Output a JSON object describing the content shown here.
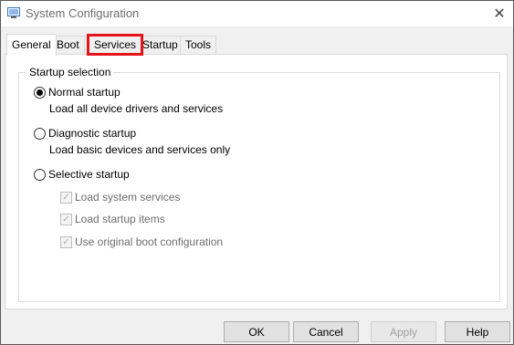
{
  "window": {
    "title": "System Configuration",
    "close_glyph": "✕"
  },
  "tabs": [
    {
      "label": "General"
    },
    {
      "label": "Boot"
    },
    {
      "label": "Services"
    },
    {
      "label": "Startup"
    },
    {
      "label": "Tools"
    }
  ],
  "startup_selection": {
    "group_title": "Startup selection",
    "options": [
      {
        "label": "Normal startup",
        "description": "Load all device drivers and services",
        "checked": true
      },
      {
        "label": "Diagnostic startup",
        "description": "Load basic devices and services only",
        "checked": false
      },
      {
        "label": "Selective startup",
        "description": "",
        "checked": false
      }
    ],
    "selective_items": [
      {
        "label": "Load system services",
        "checked": true,
        "enabled": false
      },
      {
        "label": "Load startup items",
        "checked": true,
        "enabled": false
      },
      {
        "label": "Use original boot configuration",
        "checked": true,
        "enabled": false
      }
    ]
  },
  "buttons": {
    "ok": "OK",
    "cancel": "Cancel",
    "apply": "Apply",
    "help": "Help"
  },
  "colors": {
    "highlight": "#e5141a",
    "disabled_text": "#6d6d6d"
  }
}
